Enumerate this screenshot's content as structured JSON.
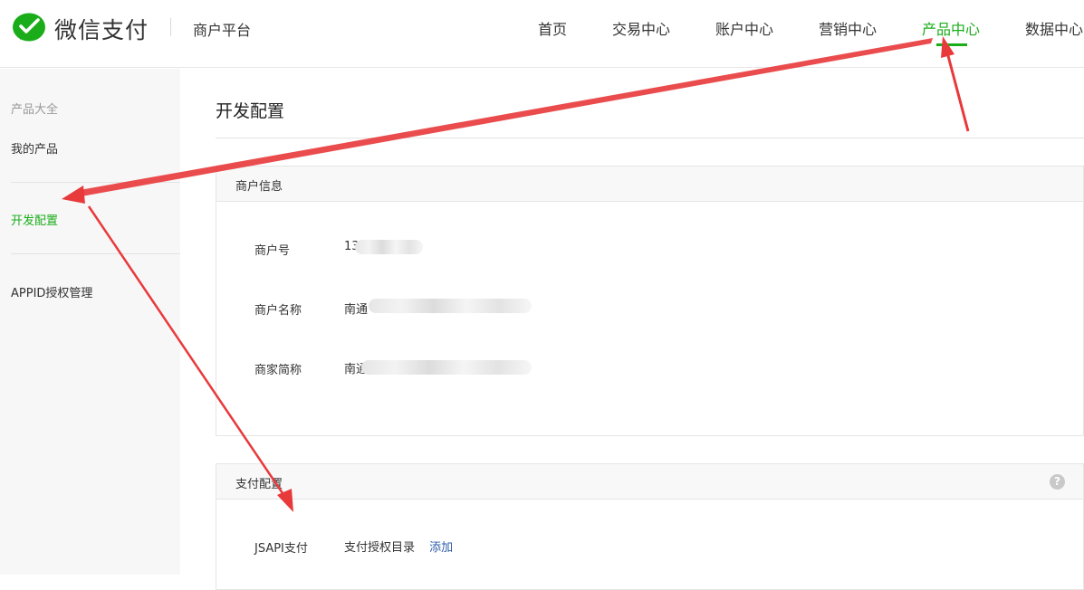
{
  "header": {
    "brand": "微信支付",
    "platform": "商户平台",
    "nav": [
      "首页",
      "交易中心",
      "账户中心",
      "营销中心",
      "产品中心",
      "数据中心"
    ],
    "active_nav": "产品中心"
  },
  "sidebar": {
    "section": "产品大全",
    "my_products": "我的产品",
    "dev_config": "开发配置",
    "appid_auth": "APPID授权管理"
  },
  "main": {
    "page_title": "开发配置",
    "merchant_info": {
      "title": "商户信息",
      "rows": [
        {
          "label": "商户号",
          "value": "13"
        },
        {
          "label": "商户名称",
          "value": "南通"
        },
        {
          "label": "商家简称",
          "value": "南通"
        }
      ]
    },
    "payment_config": {
      "title": "支付配置",
      "help": "?",
      "jsapi_label": "JSAPI支付",
      "auth_dir_label": "支付授权目录",
      "add_link": "添加"
    }
  },
  "colors": {
    "accent": "#1aad19",
    "annotation_arrow": "#e8393b",
    "link": "#2f5ea9"
  }
}
